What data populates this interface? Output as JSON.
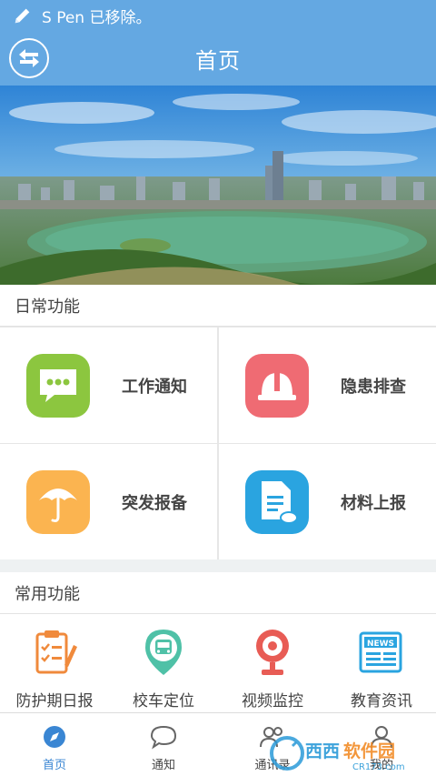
{
  "status_bar": {
    "text": "S Pen 已移除。"
  },
  "header": {
    "title": "首页"
  },
  "sections": {
    "daily": "日常功能",
    "common": "常用功能"
  },
  "daily_functions": [
    {
      "label": "工作通知",
      "icon": "message-icon",
      "color": "#8cc63f"
    },
    {
      "label": "隐患排查",
      "icon": "hard-hat-icon",
      "color": "#ef6b73"
    },
    {
      "label": "突发报备",
      "icon": "umbrella-icon",
      "color": "#fbb450"
    },
    {
      "label": "材料上报",
      "icon": "document-cloud-icon",
      "color": "#2aa4e0"
    }
  ],
  "common_functions": [
    {
      "label": "防护期日报",
      "icon": "checklist-icon"
    },
    {
      "label": "校车定位",
      "icon": "bus-location-icon"
    },
    {
      "label": "视频监控",
      "icon": "camera-icon"
    },
    {
      "label": "教育资讯",
      "icon": "news-icon"
    }
  ],
  "tabs": [
    {
      "label": "首页",
      "icon": "compass-icon",
      "active": true
    },
    {
      "label": "通知",
      "icon": "chat-icon",
      "active": false
    },
    {
      "label": "通讯录",
      "icon": "contacts-icon",
      "active": false
    },
    {
      "label": "我的",
      "icon": "user-icon",
      "active": false
    }
  ],
  "watermark": {
    "brand": "西西软件园",
    "domain": "CR173.com"
  },
  "colors": {
    "primary": "#64a8e2",
    "tab_active": "#3a86d3"
  }
}
